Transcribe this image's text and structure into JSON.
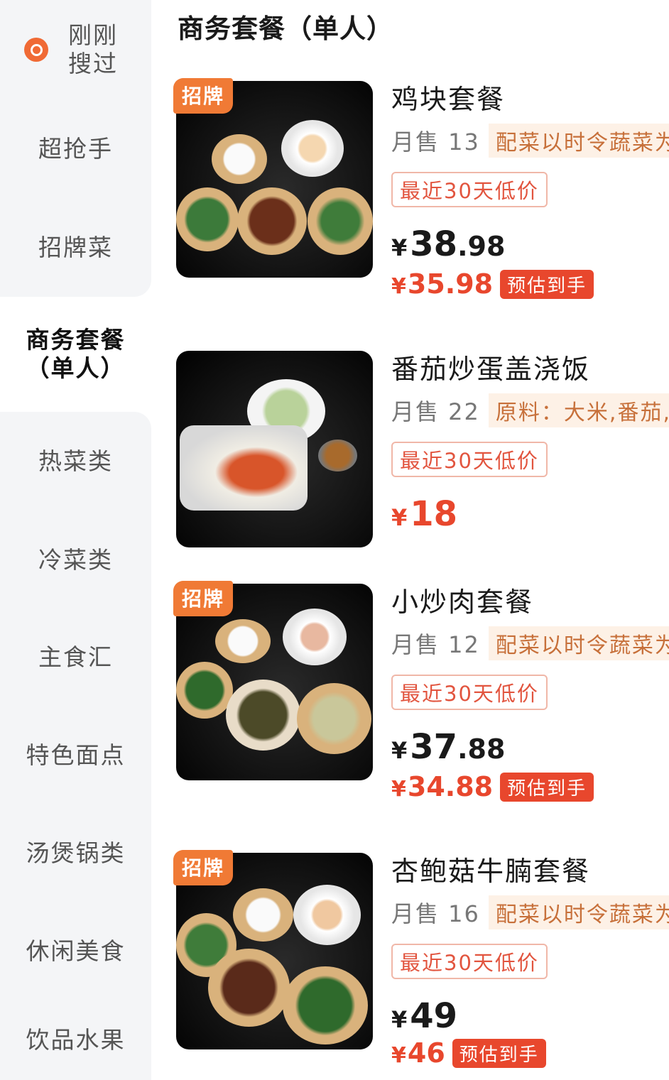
{
  "sidebar": {
    "recent_label": "刚刚搜过",
    "items": [
      {
        "label": "超抢手"
      },
      {
        "label": "招牌菜"
      },
      {
        "label": "商务套餐（单人）"
      },
      {
        "label": "热菜类"
      },
      {
        "label": "冷菜类"
      },
      {
        "label": "主食汇"
      },
      {
        "label": "特色面点"
      },
      {
        "label": "汤煲锅类"
      },
      {
        "label": "休闲美食"
      },
      {
        "label": "饮品水果"
      }
    ],
    "active_index": 2
  },
  "section_title": "商务套餐（单人）",
  "products": [
    {
      "badge": "招牌",
      "name": "鸡块套餐",
      "sales": "月售 13",
      "desc": "配菜以时令蔬菜为",
      "low_price_tag": "最近30天低价",
      "price_yen": "¥",
      "price_int": "38",
      "price_dec": ".98",
      "est_yen": "¥",
      "est_price": "35.98",
      "est_label": "预估到手"
    },
    {
      "badge": "",
      "name": "番茄炒蛋盖浇饭",
      "sales": "月售 22",
      "desc": "原料：大米,番茄,鸡",
      "low_price_tag": "最近30天低价",
      "price_yen": "¥",
      "price_int": "18",
      "price_dec": ""
    },
    {
      "badge": "招牌",
      "name": "小炒肉套餐",
      "sales": "月售 12",
      "desc": "配菜以时令蔬菜为",
      "low_price_tag": "最近30天低价",
      "price_yen": "¥",
      "price_int": "37",
      "price_dec": ".88",
      "est_yen": "¥",
      "est_price": "34.88",
      "est_label": "预估到手"
    },
    {
      "badge": "招牌",
      "name": "杏鲍菇牛腩套餐",
      "sales": "月售 16",
      "desc": "配菜以时令蔬菜为",
      "low_price_tag": "最近30天低价",
      "price_yen": "¥",
      "price_int": "49",
      "price_dec": "",
      "est_yen": "¥",
      "est_price": "46",
      "est_label": "预估到手"
    }
  ],
  "colors": {
    "accent_orange": "#f07a35",
    "price_red": "#e8472d",
    "sidebar_bg": "#f4f5f7"
  }
}
